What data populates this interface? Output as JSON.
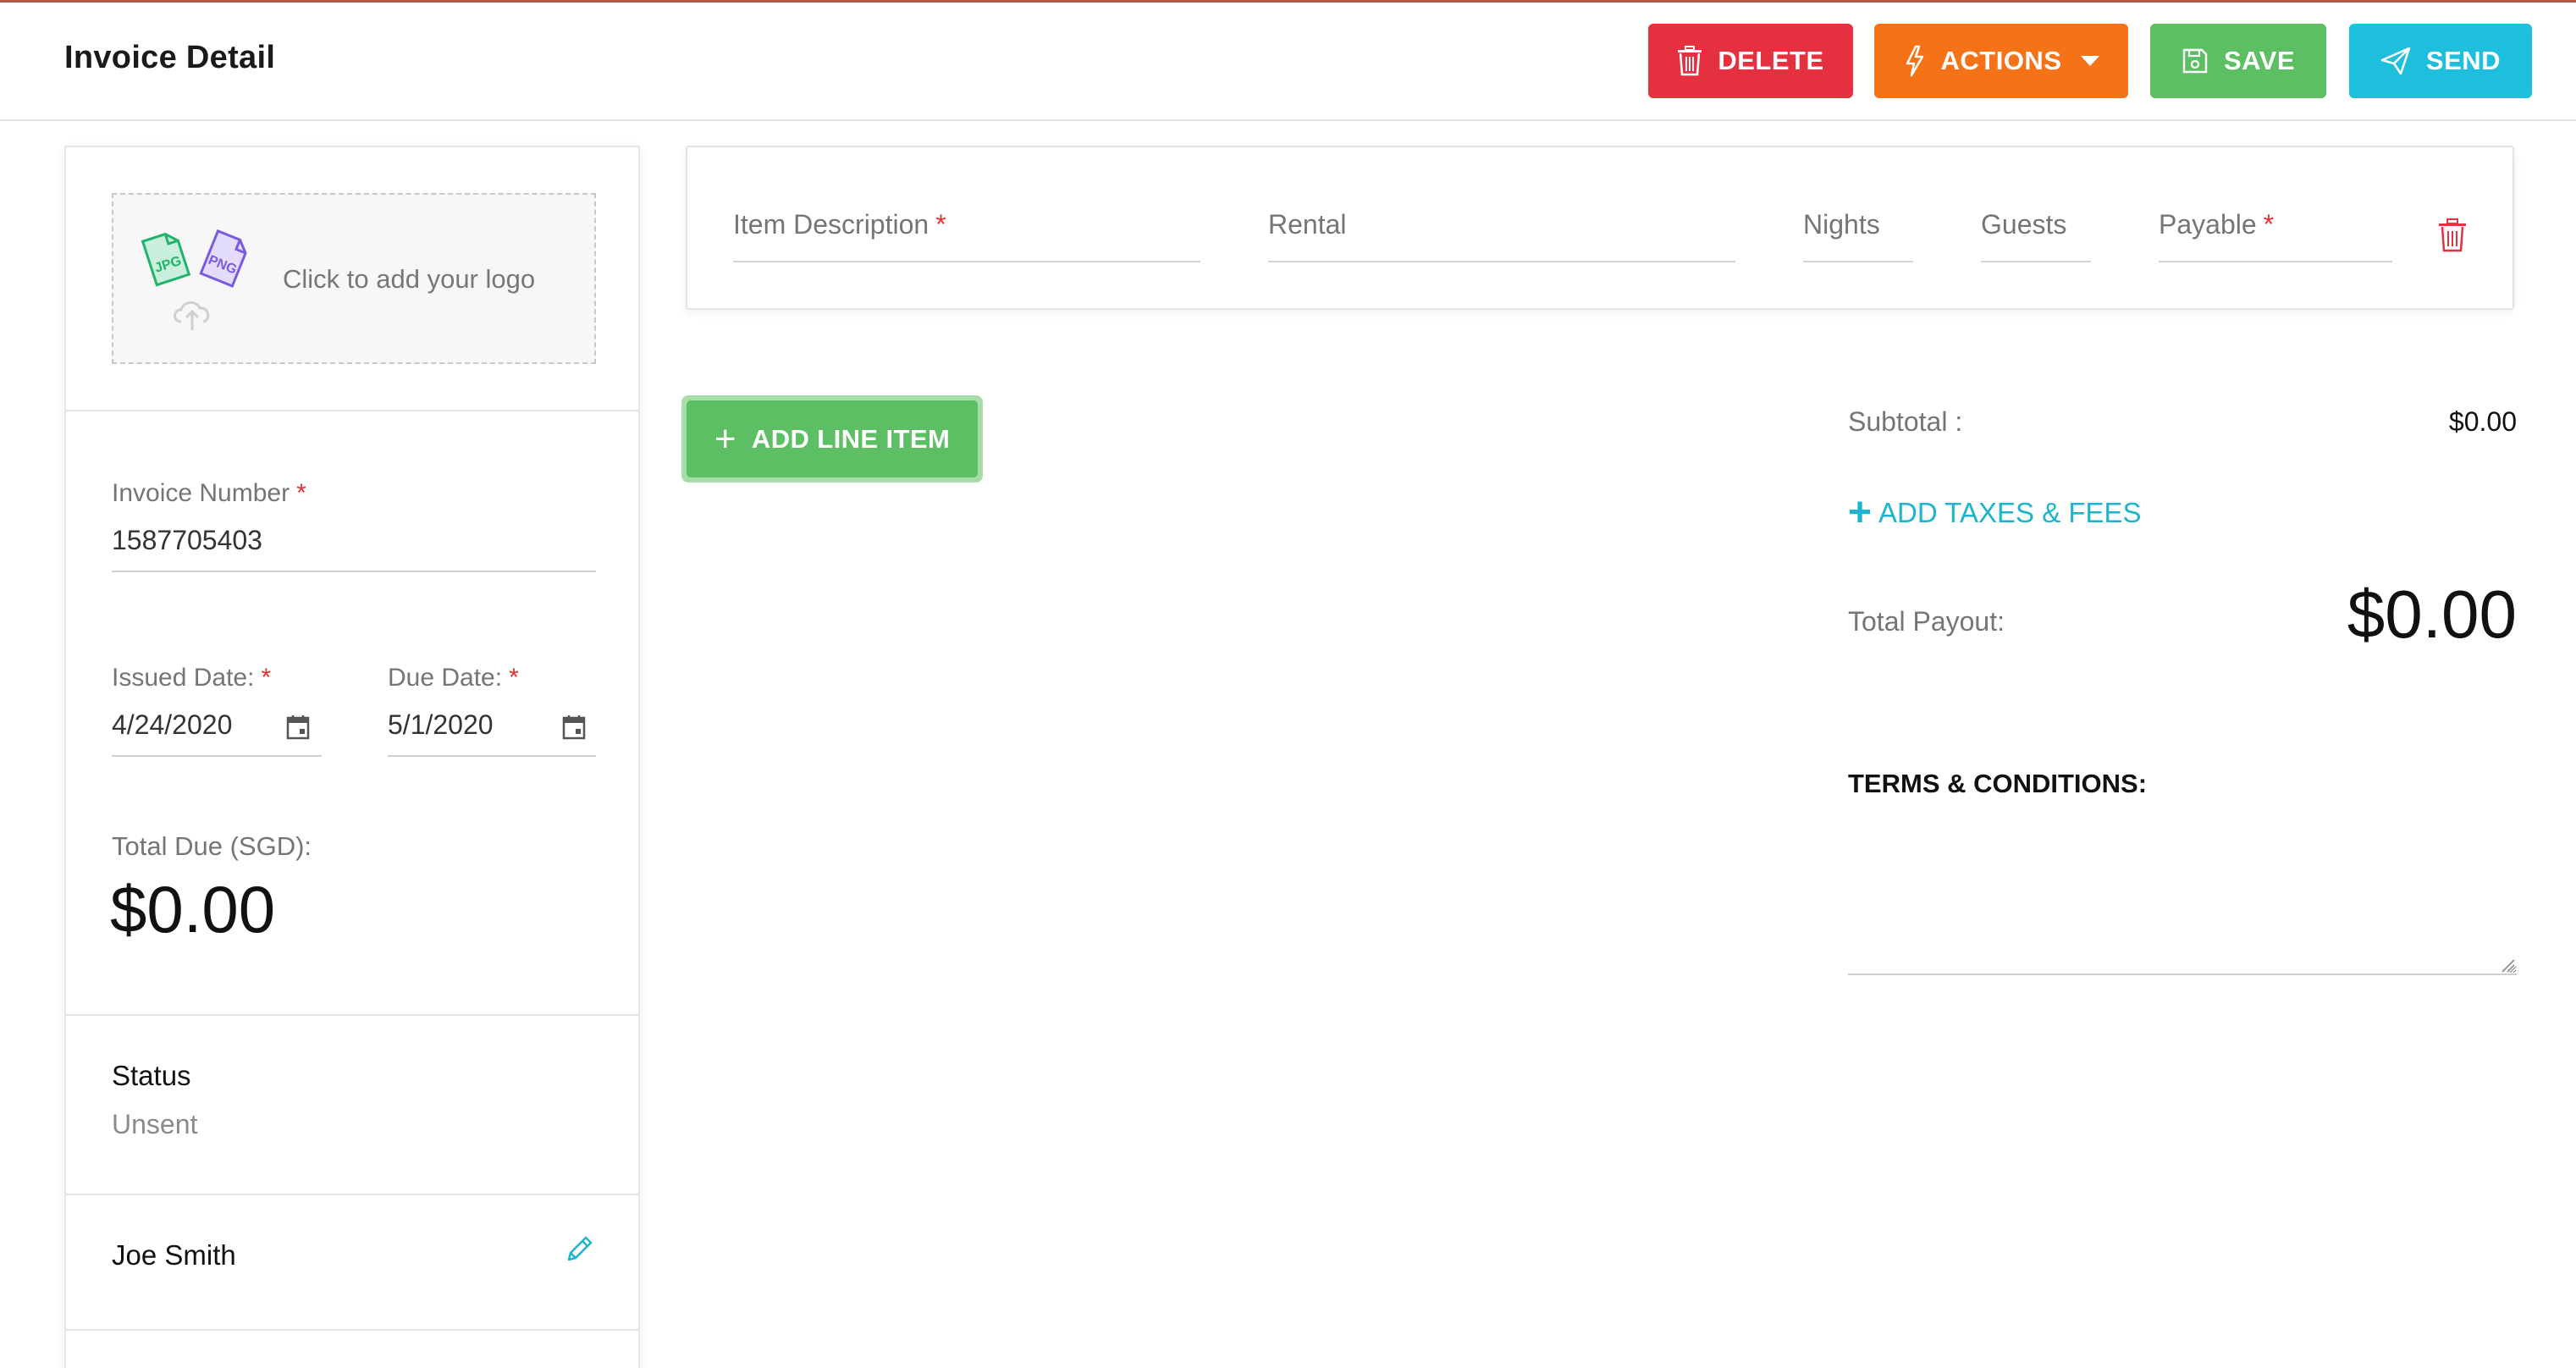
{
  "header": {
    "title": "Invoice Detail",
    "buttons": {
      "delete": "DELETE",
      "actions": "ACTIONS",
      "save": "SAVE",
      "send": "SEND"
    }
  },
  "sidebar": {
    "logo_prompt": "Click to add your logo",
    "invoice_number": {
      "label": "Invoice Number",
      "value": "1587705403"
    },
    "issued_date": {
      "label": "Issued Date:",
      "value": "4/24/2020"
    },
    "due_date": {
      "label": "Due Date:",
      "value": "5/1/2020"
    },
    "total_due": {
      "label": "Total Due (SGD):",
      "value": "$0.00"
    },
    "status": {
      "label": "Status",
      "value": "Unsent"
    },
    "client": {
      "name": "Joe Smith"
    },
    "required_mark": "*"
  },
  "line_items": {
    "columns": {
      "description": "Item Description",
      "rental": "Rental",
      "nights": "Nights",
      "guests": "Guests",
      "payable": "Payable"
    },
    "add_button": "ADD LINE ITEM"
  },
  "summary": {
    "subtotal_label": "Subtotal :",
    "subtotal_value": "$0.00",
    "add_taxes": "ADD TAXES & FEES",
    "payout_label": "Total Payout:",
    "payout_value": "$0.00",
    "terms_label": "TERMS & CONDITIONS:",
    "terms_value": ""
  },
  "colors": {
    "delete": "#e5303f",
    "actions": "#f57217",
    "save": "#5cbf63",
    "send": "#1ebfdd",
    "required": "#e0322f"
  },
  "icons": [
    "trash-icon",
    "bolt-icon",
    "save-icon",
    "send-icon",
    "calendar-icon",
    "pencil-icon",
    "upload-icon",
    "jpg-file-icon",
    "png-file-icon"
  ]
}
